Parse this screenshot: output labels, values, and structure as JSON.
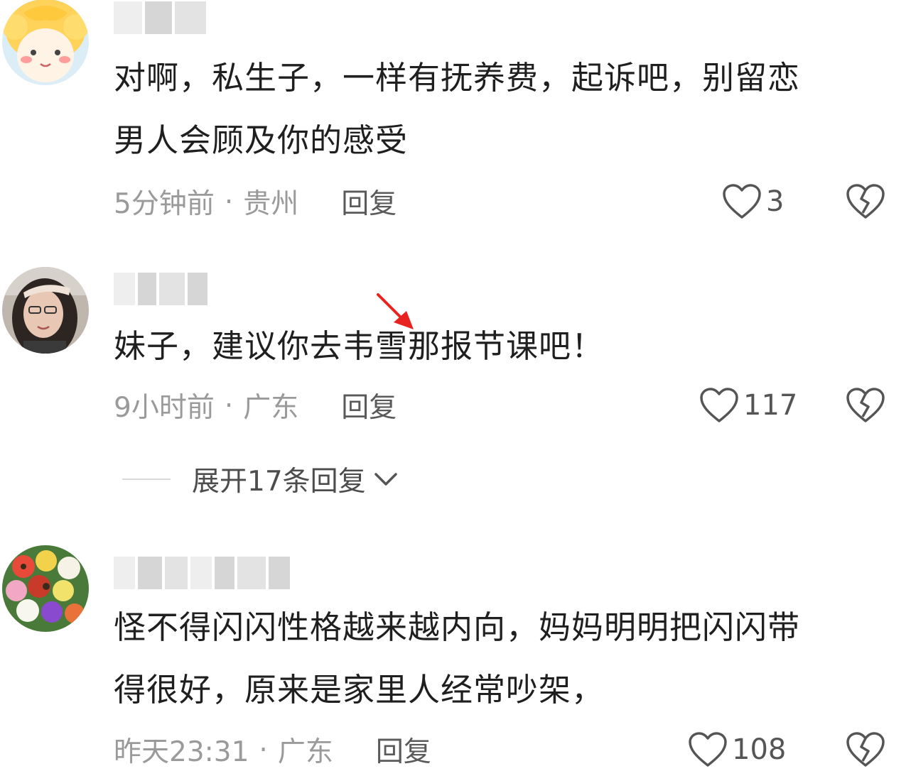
{
  "comments": [
    {
      "text": "对啊，私生子，一样有抚养费，起诉吧，别留恋\n男人会顾及你的感受",
      "time": "5分钟前",
      "location": "贵州",
      "reply_label": "回复",
      "likes": "3"
    },
    {
      "text": "妹子，建议你去韦雪那报节课吧！",
      "time": "9小时前",
      "location": "广东",
      "reply_label": "回复",
      "likes": "117",
      "expand_label": "展开17条回复"
    },
    {
      "text": "怪不得闪闪性格越来越内向，妈妈明明把闪闪带\n得很好，原来是家里人经常吵架，",
      "time": "昨天23:31",
      "location": "广东",
      "reply_label": "回复",
      "likes": "108"
    }
  ],
  "separator": "·",
  "icons": {
    "like": "heart-outline-icon",
    "dislike": "broken-heart-icon",
    "expand": "chevron-down-icon",
    "annotation": "red-arrow-icon"
  },
  "colors": {
    "text": "#1f1f1f",
    "meta": "#9a9a9a",
    "reply": "#5a5a5a",
    "annotation": "#e8231f"
  }
}
